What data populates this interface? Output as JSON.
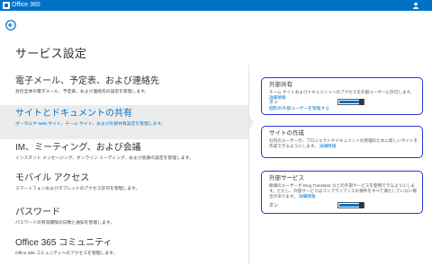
{
  "app": {
    "title": "Office 365"
  },
  "page": {
    "title": "サービス設定"
  },
  "nav": {
    "items": [
      {
        "label": "電子メール、予定表、および連絡先",
        "desc": "会社全体の電子メール、予定表、および連絡先の設定を管理します。"
      },
      {
        "label": "サイトとドキュメントの共有",
        "desc": "ポータルや Web サイト、チーム サイト、および外部共有設定を管理します。"
      },
      {
        "label": "IM、ミーティング、および会議",
        "desc": "インスタント メッセージング、オンライン ミーティング、および会議の設定を管理します。"
      },
      {
        "label": "モバイル アクセス",
        "desc": "スマートフォンおよびタブレットのアクセス許可を管理します。"
      },
      {
        "label": "パスワード",
        "desc": "パスワードの有効期限の日数と通知を管理します。"
      },
      {
        "label": "Office 365 コミュニティ",
        "desc": "Office 365 コミュニティへのアクセスを管理します。"
      }
    ]
  },
  "panels": {
    "external_sharing": {
      "title": "外部共有",
      "desc": "チーム サイトおよびドキュメントへのアクセスを外部ユーザーに許可します。",
      "link": "詳細情報",
      "on_label": "オン",
      "toggle_on": true,
      "ext_link": "個別の外部ユーザーを管理する"
    },
    "site_creation": {
      "title": "サイトの作成",
      "desc": "社内のユーザーが、プロジェクトやドキュメントの管理のために新しいサイトを作成できるようにします。",
      "link": "詳細情報"
    },
    "external_services": {
      "title": "外部サービス",
      "desc": "組織のユーザーが Bing Translator などの外部サービスを使用できるようにします。ただし、外部サービスはコンプライアンスの要件をすべて満たしていない場合があります。",
      "link": "詳細情報",
      "on_label": "オン",
      "toggle_on": true
    }
  },
  "colors": {
    "brand_blue": "#0072c6",
    "annotation_outline": "#2b33d4",
    "selected_bg": "#ececec"
  },
  "icons": {
    "back": "back-arrow-circle-icon",
    "app_logo": "office-logo-icon",
    "user": "user-icon"
  }
}
